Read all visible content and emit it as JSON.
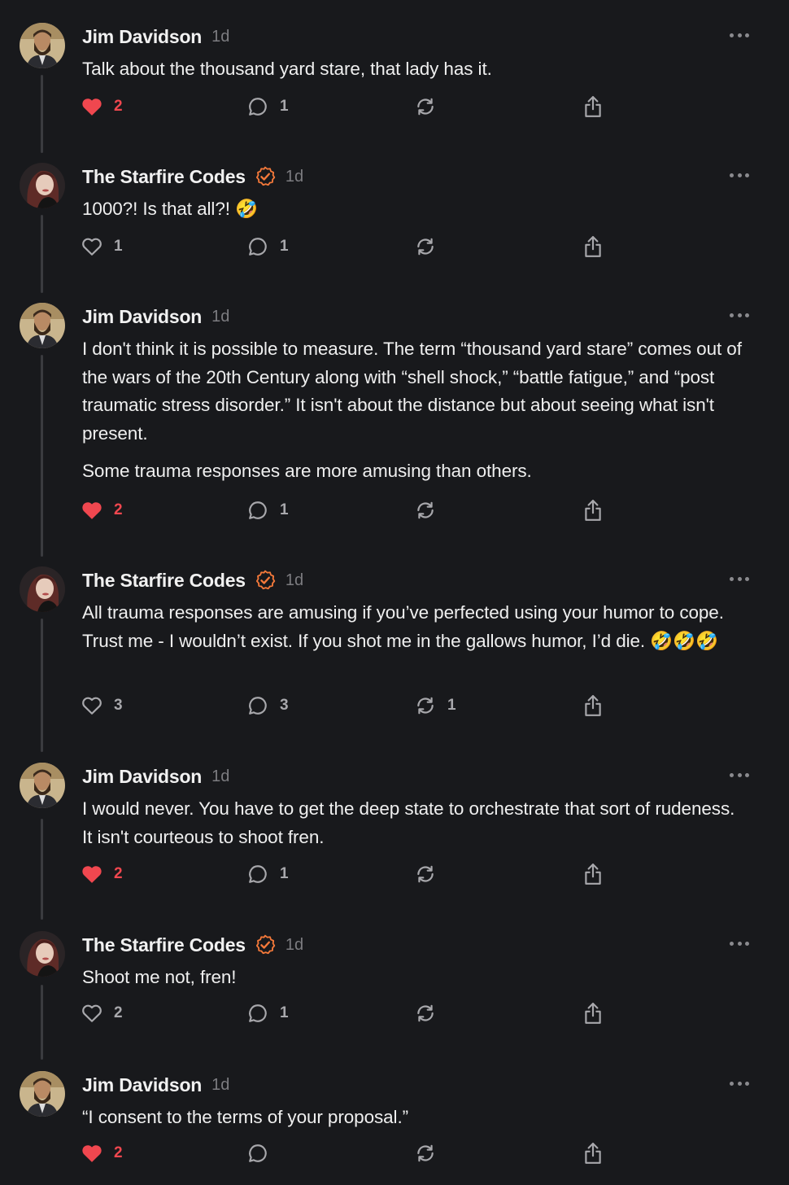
{
  "colors": {
    "background": "#18191c",
    "liked": "#f0474f",
    "verified": "#f4793a",
    "muted": "#7c7c80"
  },
  "icons": {
    "like": "heart-icon",
    "reply": "comment-bubble-icon",
    "repost": "repost-icon",
    "share": "share-icon",
    "more": "more-dots-icon",
    "verified": "verified-badge-icon"
  },
  "posts": [
    {
      "author": "Jim Davidson",
      "time": "1d",
      "verified": false,
      "paragraphs": [
        "Talk about the thousand yard stare, that lady has it."
      ],
      "likes": "2",
      "liked": true,
      "replies": "1",
      "reposts": ""
    },
    {
      "author": "The Starfire Codes",
      "time": "1d",
      "verified": true,
      "paragraphs": [
        "1000?! Is that all?! 🤣"
      ],
      "likes": "1",
      "liked": false,
      "replies": "1",
      "reposts": ""
    },
    {
      "author": "Jim Davidson",
      "time": "1d",
      "verified": false,
      "paragraphs": [
        "I don't think it is possible to measure. The term “thousand yard stare” comes out of the wars of the 20th Century along with “shell shock,” “battle fatigue,” and “post traumatic stress disorder.” It isn't about the distance but about seeing what isn't present.",
        "Some trauma responses are more amusing than others."
      ],
      "likes": "2",
      "liked": true,
      "replies": "1",
      "reposts": ""
    },
    {
      "author": "The Starfire Codes",
      "time": "1d",
      "verified": true,
      "paragraphs": [
        "All trauma responses are amusing if you’ve perfected using your humor to cope. Trust me - I wouldn’t exist. If you shot me in the gallows humor, I’d die. 🤣🤣🤣"
      ],
      "likes": "3",
      "liked": false,
      "replies": "3",
      "reposts": "1"
    },
    {
      "author": "Jim Davidson",
      "time": "1d",
      "verified": false,
      "paragraphs": [
        "I would never. You have to get the deep state to orchestrate that sort of rudeness. It isn't courteous to shoot fren."
      ],
      "likes": "2",
      "liked": true,
      "replies": "1",
      "reposts": ""
    },
    {
      "author": "The Starfire Codes",
      "time": "1d",
      "verified": true,
      "paragraphs": [
        "Shoot me not, fren!"
      ],
      "likes": "2",
      "liked": false,
      "replies": "1",
      "reposts": ""
    },
    {
      "author": "Jim Davidson",
      "time": "1d",
      "verified": false,
      "paragraphs": [
        "“I consent to the terms of your proposal.”"
      ],
      "likes": "2",
      "liked": true,
      "replies": "",
      "reposts": ""
    }
  ]
}
